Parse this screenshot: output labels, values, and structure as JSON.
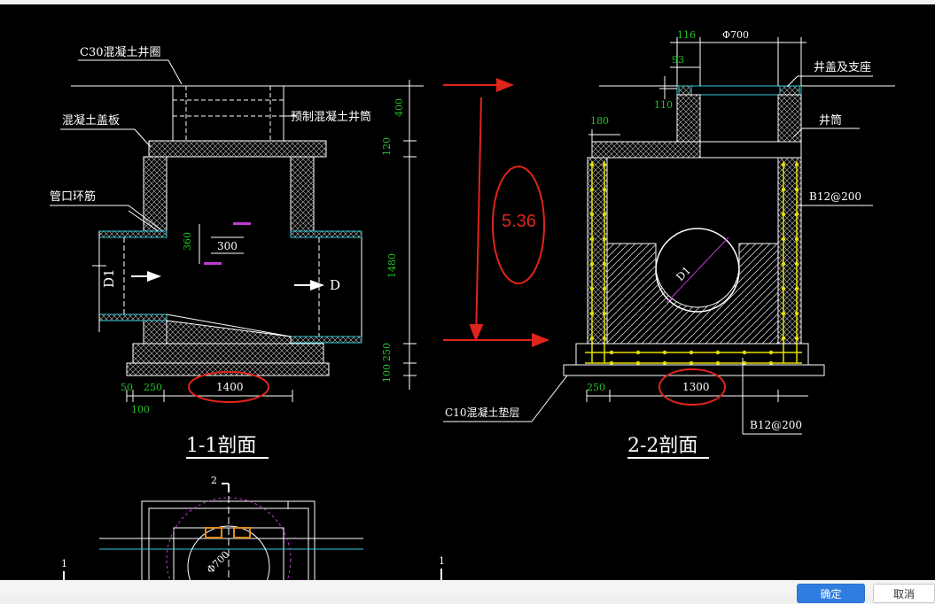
{
  "drawing": {
    "labels": {
      "c30_ring": "C30混凝土井圈",
      "cover_slab": "混凝土盖板",
      "precast_tube": "预制混凝土井筒",
      "pipe_ring_rebar": "管口环筋",
      "cover_support": "井盖及支座",
      "tube": "井筒",
      "rebar_side": "B12@200",
      "rebar_bottom": "B12@200",
      "c10_cushion": "C10混凝土垫层",
      "pipe_d1": "D1",
      "pipe_d": "D",
      "pipe_d1_circle": "D1",
      "phi700_plan": "Φ700"
    },
    "dims_left": {
      "d400": "400",
      "d120": "120",
      "d1480": "1480",
      "d250": "250",
      "d100": "100",
      "d360": "360",
      "d300": "300",
      "d50": "50",
      "d250b": "250",
      "d1400": "1400",
      "d100b": "100"
    },
    "dims_right": {
      "d116": "116",
      "phi700": "Φ700",
      "d93": "93",
      "d110": "110",
      "d180": "180",
      "d250": "250",
      "d1300": "1300"
    },
    "section_titles": {
      "s11": "1-1剖面",
      "s22": "2-2剖面"
    },
    "annotation": {
      "value": "5.36",
      "color": "#e0241b"
    },
    "plan_markers": {
      "m2": "2",
      "m1a": "1",
      "m1b": "1"
    }
  },
  "dialog": {
    "confirm_label": "确定",
    "cancel_label": "取消"
  },
  "colors": {
    "background": "#000000",
    "line": "#ffffff",
    "dimension": "#23c423",
    "rebar": "#e6e000",
    "cyan": "#33c8d6",
    "magenta": "#c23ad6",
    "annotation": "#e0241b"
  }
}
